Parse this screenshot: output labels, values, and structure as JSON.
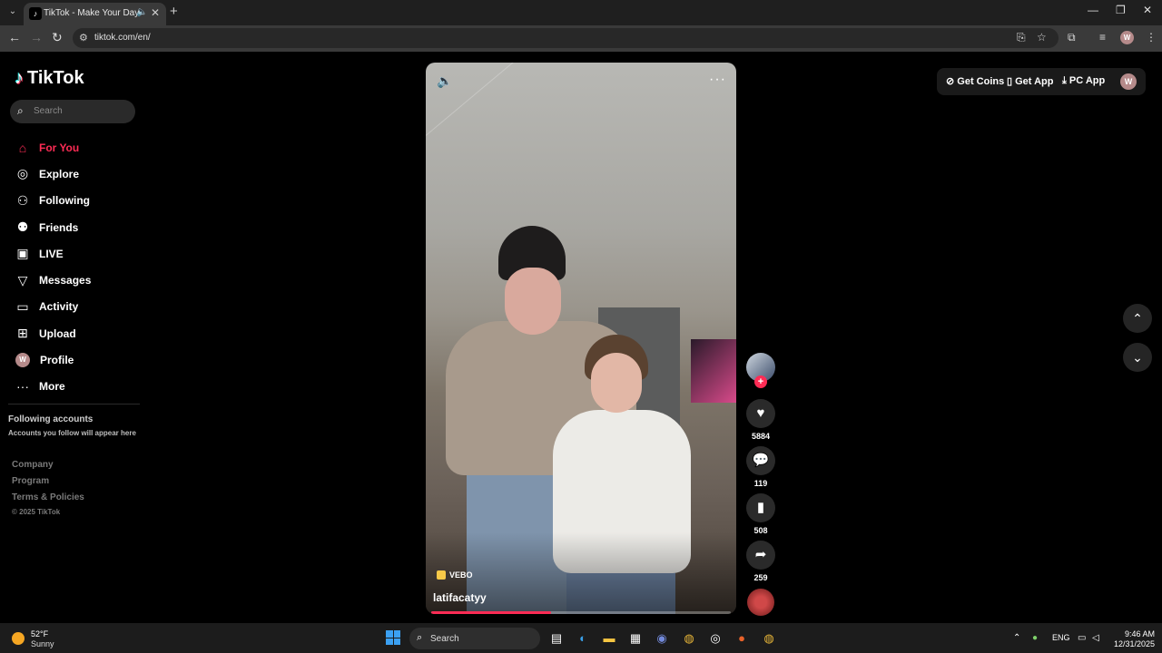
{
  "browser": {
    "tab_title": "TikTok - Make Your Day",
    "url": "tiktok.com/en/",
    "profile_initial": "W"
  },
  "sidebar": {
    "logo": "TikTok",
    "search_placeholder": "Search",
    "nav": [
      {
        "label": "For You",
        "icon": "home-icon",
        "active": true
      },
      {
        "label": "Explore",
        "icon": "compass-icon"
      },
      {
        "label": "Following",
        "icon": "following-icon"
      },
      {
        "label": "Friends",
        "icon": "friends-icon"
      },
      {
        "label": "LIVE",
        "icon": "live-icon"
      },
      {
        "label": "Messages",
        "icon": "messages-icon"
      },
      {
        "label": "Activity",
        "icon": "activity-icon"
      },
      {
        "label": "Upload",
        "icon": "upload-icon"
      },
      {
        "label": "Profile",
        "icon": "avatar"
      },
      {
        "label": "More",
        "icon": "more-icon"
      }
    ],
    "profile_initial": "W",
    "following_title": "Following accounts",
    "following_sub": "Accounts you follow will appear here",
    "footer": [
      "Company",
      "Program",
      "Terms & Policies"
    ],
    "copyright": "© 2025 TikTok"
  },
  "video": {
    "badge": "VEBO",
    "author": "latifacatyy",
    "progress_pct": 40
  },
  "actions": {
    "likes": "5884",
    "comments": "119",
    "saves": "508",
    "shares": "259"
  },
  "topbar": {
    "get_coins": "Get Coins",
    "get_app": "Get App",
    "pc_app": "PC App",
    "profile_initial": "W"
  },
  "taskbar": {
    "temp": "52°F",
    "condition": "Sunny",
    "search_placeholder": "Search",
    "lang": "ENG",
    "time": "9:46 AM",
    "date": "12/31/2025"
  },
  "colors": {
    "accent": "#fe2c55",
    "background": "#000000"
  }
}
